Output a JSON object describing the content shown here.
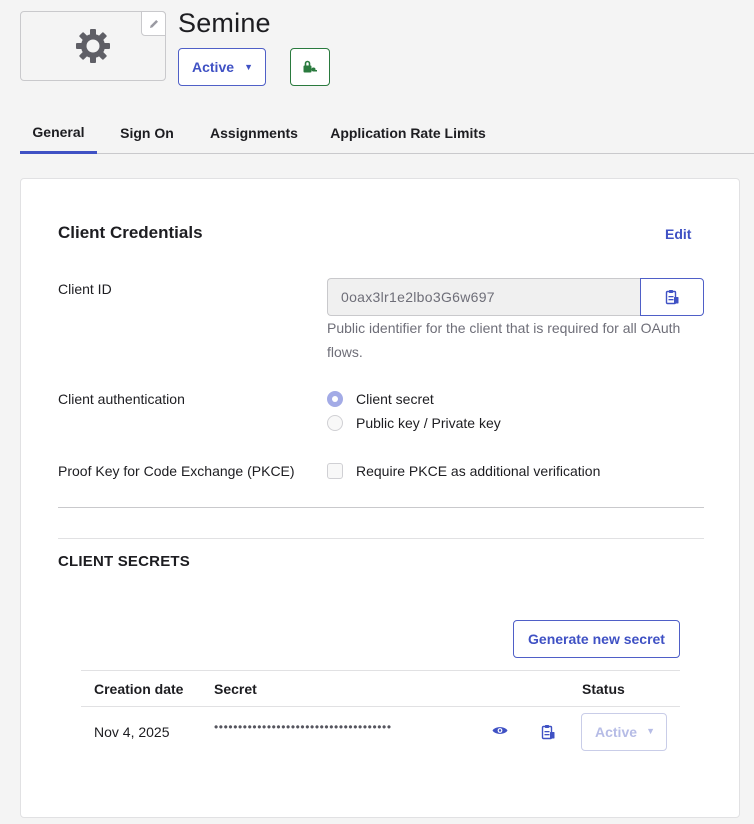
{
  "app": {
    "title": "Semine",
    "status_label": "Active"
  },
  "tabs": [
    {
      "label": "General",
      "active": true
    },
    {
      "label": "Sign On",
      "active": false
    },
    {
      "label": "Assignments",
      "active": false
    },
    {
      "label": "Application Rate Limits",
      "active": false
    }
  ],
  "credentials": {
    "title": "Client Credentials",
    "edit_label": "Edit",
    "client_id_label": "Client ID",
    "client_id_value": "0oax3lr1e2lbo3G6w697",
    "client_id_help": "Public identifier for the client that is required for all OAuth flows.",
    "auth_label": "Client authentication",
    "auth_options": [
      {
        "label": "Client secret",
        "checked": true
      },
      {
        "label": "Public key / Private key",
        "checked": false
      }
    ],
    "pkce_label": "Proof Key for Code Exchange (PKCE)",
    "pkce_option": "Require PKCE as additional verification",
    "pkce_checked": false
  },
  "secrets": {
    "title": "CLIENT SECRETS",
    "generate_label": "Generate new secret",
    "columns": [
      "Creation date",
      "Secret",
      "Status"
    ],
    "rows": [
      {
        "created": "Nov 4, 2025",
        "secret_masked": "•••••••••••••••••••••••••••••••••••••",
        "status": "Active"
      }
    ]
  },
  "colors": {
    "accent": "#3f51c4",
    "success": "#2a7a3e",
    "border": "#c9c9cc",
    "muted_text": "#6e6e78"
  },
  "icons": {
    "logo": "gear-icon",
    "logo_edit": "pencil-icon",
    "push": "green-lock-key-icon",
    "copy": "clipboard-copy-icon",
    "reveal": "eye-icon",
    "caret": "chevron-down-icon"
  }
}
